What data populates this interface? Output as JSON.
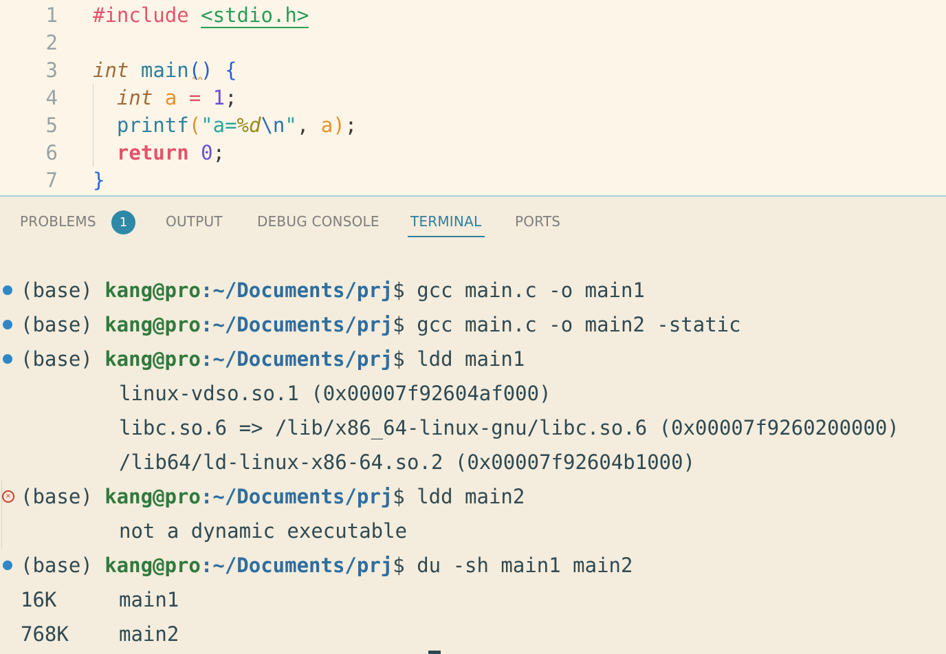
{
  "editor": {
    "lines": [
      {
        "n": "1",
        "tokens": [
          {
            "c": "kw-pre",
            "t": "#include "
          },
          {
            "c": "inc-str",
            "t": "<stdio.h>"
          }
        ]
      },
      {
        "n": "2",
        "tokens": []
      },
      {
        "n": "3",
        "tokens": [
          {
            "c": "type",
            "t": "int"
          },
          {
            "c": "punc",
            "t": " "
          },
          {
            "c": "fn",
            "t": "main"
          },
          {
            "c": "brace",
            "t": "()"
          },
          {
            "c": "punc",
            "t": " "
          },
          {
            "c": "brace",
            "t": "{"
          }
        ]
      },
      {
        "n": "4",
        "tokens": [
          {
            "c": "punc",
            "t": "  "
          },
          {
            "c": "type",
            "t": "int"
          },
          {
            "c": "punc",
            "t": " "
          },
          {
            "c": "var",
            "t": "a"
          },
          {
            "c": "punc",
            "t": " "
          },
          {
            "c": "op",
            "t": "="
          },
          {
            "c": "punc",
            "t": " "
          },
          {
            "c": "num",
            "t": "1"
          },
          {
            "c": "punc",
            "t": ";"
          }
        ]
      },
      {
        "n": "5",
        "tokens": [
          {
            "c": "punc",
            "t": "  "
          },
          {
            "c": "fn",
            "t": "printf"
          },
          {
            "c": "var",
            "t": "("
          },
          {
            "c": "str",
            "t": "\"a="
          },
          {
            "c": "fmt",
            "t": "%d"
          },
          {
            "c": "esc",
            "t": "\\n"
          },
          {
            "c": "str",
            "t": "\""
          },
          {
            "c": "punc",
            "t": ", "
          },
          {
            "c": "var",
            "t": "a"
          },
          {
            "c": "var",
            "t": ")"
          },
          {
            "c": "punc",
            "t": ";"
          }
        ]
      },
      {
        "n": "6",
        "tokens": [
          {
            "c": "punc",
            "t": "  "
          },
          {
            "c": "ret",
            "t": "return"
          },
          {
            "c": "punc",
            "t": " "
          },
          {
            "c": "num",
            "t": "0"
          },
          {
            "c": "punc",
            "t": ";"
          }
        ]
      },
      {
        "n": "7",
        "tokens": [
          {
            "c": "brace",
            "t": "}"
          }
        ]
      }
    ]
  },
  "panel": {
    "tabs": {
      "problems": "PROBLEMS",
      "problems_count": "1",
      "output": "OUTPUT",
      "debug_console": "DEBUG CONSOLE",
      "terminal": "TERMINAL",
      "ports": "PORTS"
    }
  },
  "terminal": {
    "prompt_env": "(base) ",
    "prompt_user": "kang@pro",
    "prompt_path": ":~/Documents/prj",
    "prompt_sign": "$ ",
    "lines": [
      {
        "kind": "cmd",
        "status": "ok",
        "cmd": "gcc main.c -o main1"
      },
      {
        "kind": "cmd",
        "status": "ok",
        "cmd": "gcc main.c -o main2 -static"
      },
      {
        "kind": "cmd",
        "status": "ok",
        "cmd": "ldd main1"
      },
      {
        "kind": "out",
        "text": "linux-vdso.so.1 (0x00007f92604af000)"
      },
      {
        "kind": "out",
        "text": "libc.so.6 => /lib/x86_64-linux-gnu/libc.so.6 (0x00007f9260200000)"
      },
      {
        "kind": "out",
        "text": "/lib64/ld-linux-x86-64.so.2 (0x00007f92604b1000)"
      },
      {
        "kind": "cmd",
        "status": "error",
        "cmd": "ldd main2"
      },
      {
        "kind": "out",
        "text": "not a dynamic executable"
      },
      {
        "kind": "cmd",
        "status": "ok",
        "cmd": "du -sh main1 main2"
      },
      {
        "kind": "du",
        "size": "16K",
        "name": "main1"
      },
      {
        "kind": "du",
        "size": "768K",
        "name": "main2"
      }
    ]
  },
  "colors": {
    "accent": "#2d7f9e",
    "error": "#c8402e",
    "ok_dot": "#2e87c8",
    "user": "#2f7a3e",
    "path": "#2d6ea0"
  }
}
